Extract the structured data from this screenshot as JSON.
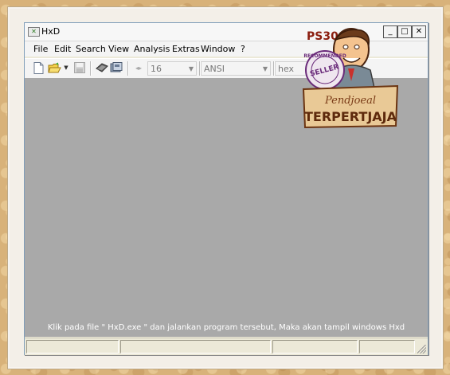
{
  "window": {
    "title": "HxD",
    "app_icon_glyph": "✕",
    "minimize_glyph": "_",
    "maximize_glyph": "□",
    "close_glyph": "✕"
  },
  "menu": {
    "items": [
      "File",
      "Edit",
      "Search",
      "View",
      "Analysis",
      "Extras",
      "Window",
      "?"
    ]
  },
  "toolbar": {
    "bytes_per_row": "16",
    "charset": "ANSI",
    "offset_base": "hex",
    "icons": [
      "new-file-icon",
      "open-folder-icon",
      "dropdown-arrow-icon",
      "save-icon",
      "open-ram-icon",
      "open-disk-icon",
      "offset-spin-icon"
    ]
  },
  "client": {
    "caption": "Klik pada file \" HxD.exe \" dan jalankan program tersebut, Maka akan tampil windows Hxd"
  },
  "watermark": {
    "brand": "PS300N",
    "ring_top": "RECOMMENDED",
    "ring_center": "SELLER",
    "sign_script": "Pendjoeal",
    "sign_title": "TERPERTJAJA"
  },
  "colors": {
    "client_bg": "#a9a9a9",
    "window_bg": "#ece9d8",
    "background_paper": "#d8b27a",
    "stamp_purple": "#6a2b7a",
    "sign_brown": "#7a3b17"
  }
}
